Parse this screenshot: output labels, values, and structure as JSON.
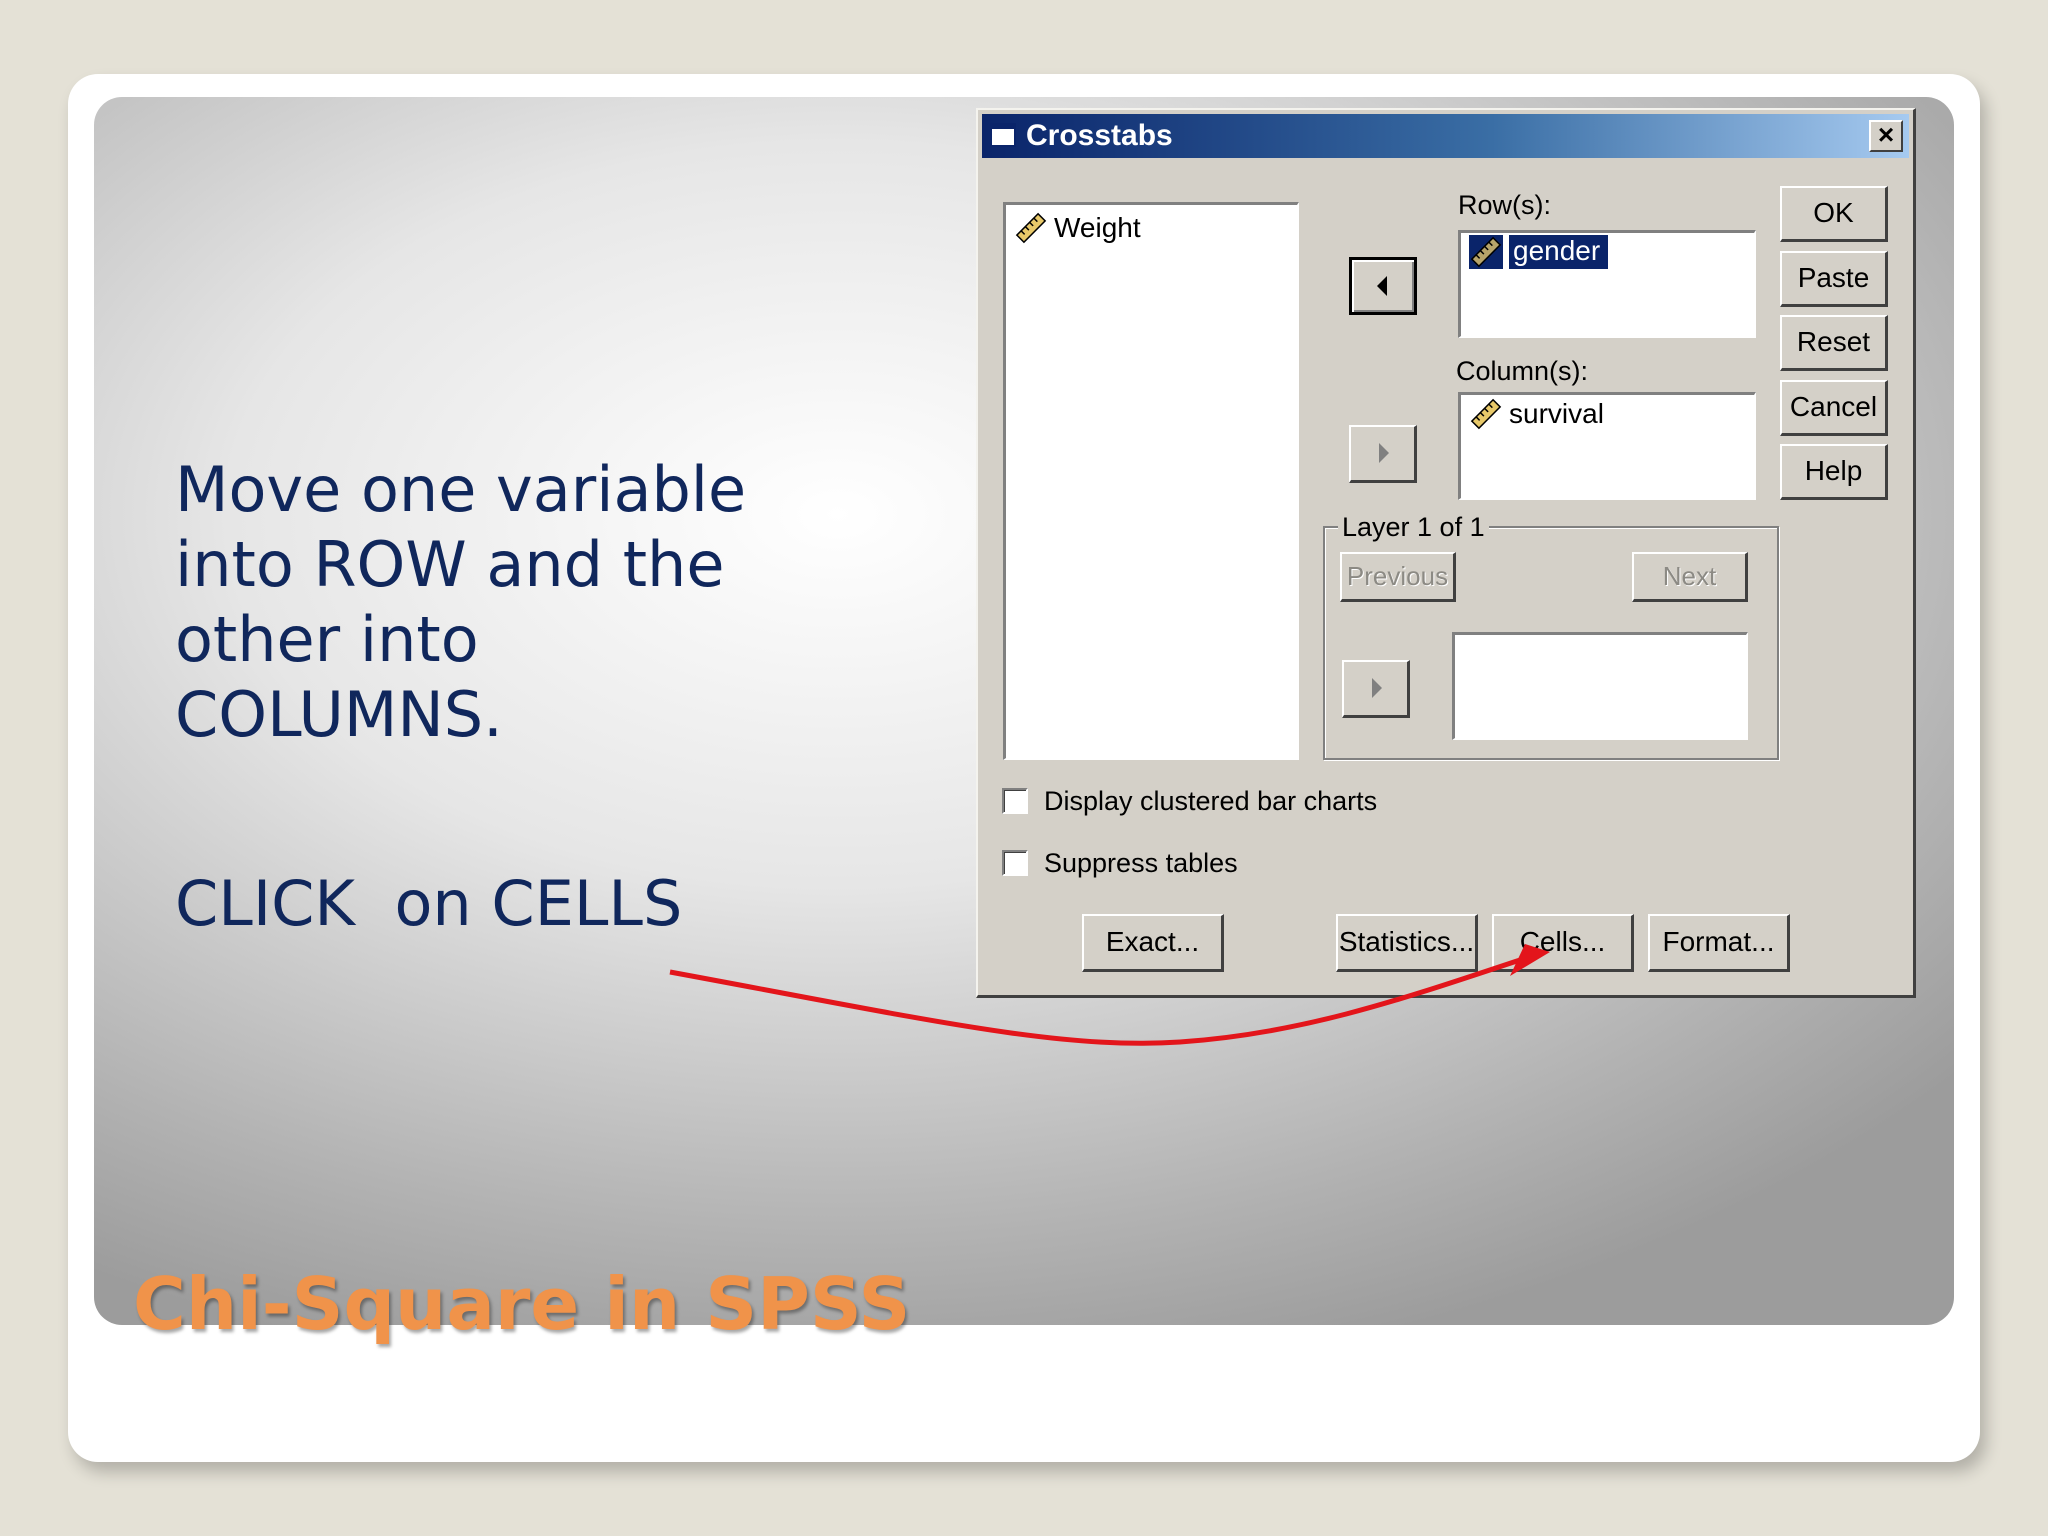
{
  "slide": {
    "body_lines": [
      "Move one variable",
      "into ROW and the",
      "other into",
      "COLUMNS."
    ],
    "click_instruction": "CLICK  on CELLS",
    "title": "Chi-Square in SPSS"
  },
  "dialog": {
    "title": "Crosstabs",
    "close_label": "×",
    "source_variables": [
      "Weight"
    ],
    "rows_label": "Row(s):",
    "rows_variables": [
      "gender"
    ],
    "columns_label": "Column(s):",
    "columns_variables": [
      "survival"
    ],
    "layer_label": "Layer 1 of 1",
    "previous_label": "Previous",
    "next_label": "Next",
    "checkbox_clustered": "Display clustered bar charts",
    "checkbox_suppress": "Suppress tables",
    "side_buttons": [
      "OK",
      "Paste",
      "Reset",
      "Cancel",
      "Help"
    ],
    "bottom_buttons": [
      "Exact...",
      "Statistics...",
      "Cells...",
      "Format..."
    ]
  },
  "annotation": {
    "arrow_color": "#e3151b"
  },
  "colors": {
    "title_orange": "#f0934a",
    "body_navy": "#10275c",
    "dialog_gray": "#d4d0c8",
    "titlebar_blue": "#0a246a"
  }
}
